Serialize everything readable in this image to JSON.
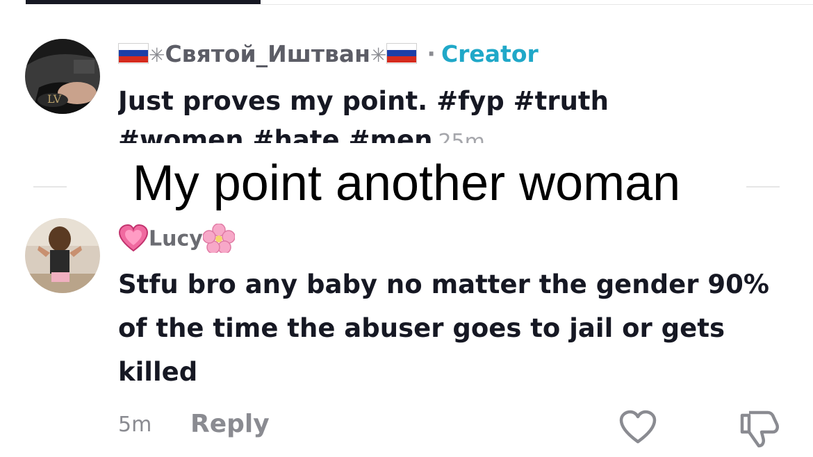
{
  "comment1": {
    "username_flag_left": "🇷🇺",
    "username_deco": "✳",
    "username": "Святой_Иштван",
    "username_flag_right": "🇷🇺",
    "separator": "·",
    "badge": "Creator",
    "text_line1": "Just proves my point. #fyp #truth",
    "text_line2": "#women #hate #men",
    "time": "25m"
  },
  "overlay_caption": "My point another woman",
  "comment2": {
    "username": "Lucy",
    "emoji_left": "💗",
    "emoji_right": "🌸",
    "text": "Stfu bro any baby no matter the gender 90% of the time the abuser goes to jail or gets killed",
    "time": "5m",
    "reply_label": "Reply"
  },
  "icons": [
    "heart-outline-icon",
    "thumbs-down-icon"
  ],
  "colors": {
    "creator_badge": "#20a8c8",
    "text_primary": "#161823",
    "text_secondary": "#8a8b91",
    "username": "#5c5d66"
  }
}
